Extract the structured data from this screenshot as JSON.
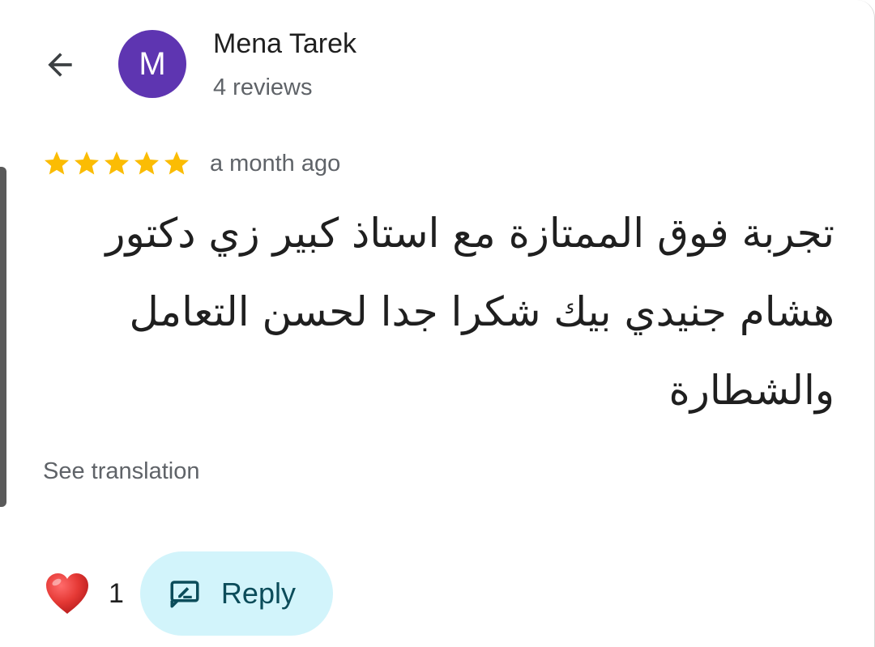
{
  "header": {
    "back_icon": "arrow-left-icon",
    "avatar_letter": "M",
    "avatar_color": "#5e35b1",
    "author_name": "Mena Tarek",
    "author_reviews": "4 reviews"
  },
  "review": {
    "rating": 5,
    "rating_max": 5,
    "star_color": "#fbbc04",
    "time_ago": "a month ago",
    "text": "تجربة فوق الممتازة مع استاذ كبير زي دكتور هشام جنيدي بيك شكرا جدا لحسن التعامل والشطارة",
    "see_translation_label": "See translation"
  },
  "actions": {
    "heart_icon": "heart-icon",
    "like_count": "1",
    "reply_icon": "reply-icon",
    "reply_label": "Reply",
    "reply_bg": "#d2f4fb"
  }
}
